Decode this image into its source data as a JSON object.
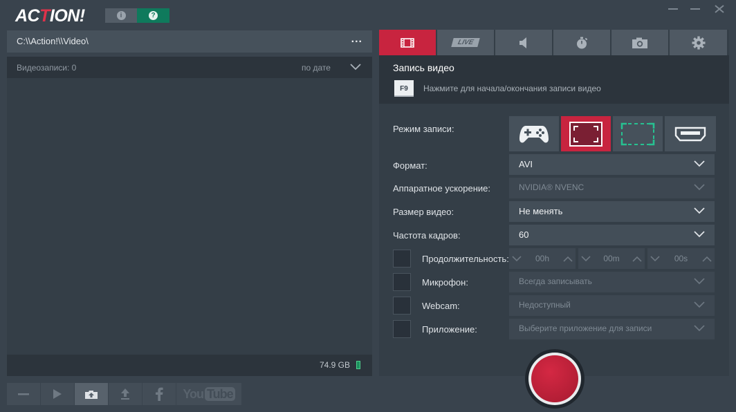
{
  "app": {
    "logo_text": "ACTION!",
    "logo_prefix": "AC",
    "logo_highlight": "T",
    "logo_suffix": "ION!",
    "info_icon": "info-icon",
    "help_icon": "help-icon",
    "colors": {
      "accent": "#c8243f",
      "help": "#0f7a5c",
      "background": "#39434d"
    }
  },
  "left": {
    "path": "C:\\\\Action!\\\\Video\\",
    "path_menu": "...",
    "list_count": "Видеозаписи: 0",
    "sort_label": "по дате",
    "disk_free": "74.9 GB",
    "bottom_buttons": [
      "minus-icon",
      "play-icon",
      "open-folder-icon",
      "upload-icon",
      "facebook-icon",
      "youtube-icon"
    ],
    "youtube_you": "You",
    "youtube_tube": "Tube"
  },
  "tabs": {
    "items": [
      "video-tab",
      "live-tab",
      "audio-tab",
      "benchmark-tab",
      "screenshot-tab",
      "settings-tab"
    ],
    "live_label": "LIVE",
    "active": "video-tab"
  },
  "video": {
    "title": "Запись видео",
    "hotkey": "F9",
    "hotkey_hint": "Нажмите для начала/окончания записи видео",
    "mode_label": "Режим записи:",
    "modes": [
      "game-mode",
      "active-window-mode",
      "region-mode",
      "hdmi-mode"
    ],
    "active_mode": "active-window-mode",
    "format_label": "Формат:",
    "format_value": "AVI",
    "hw_label": "Аппаратное ускорение:",
    "hw_value": "NVIDIA® NVENC",
    "size_label": "Размер видео:",
    "size_value": "Не менять",
    "fps_label": "Частота кадров:",
    "fps_value": "60",
    "duration_label": "Продолжительность:",
    "duration_h": "00h",
    "duration_m": "00m",
    "duration_s": "00s",
    "mic_label": "Микрофон:",
    "mic_value": "Всегда записывать",
    "webcam_label": "Webcam:",
    "webcam_value": "Недоступный",
    "app_label": "Приложение:",
    "app_value": "Выберите приложение для записи"
  }
}
